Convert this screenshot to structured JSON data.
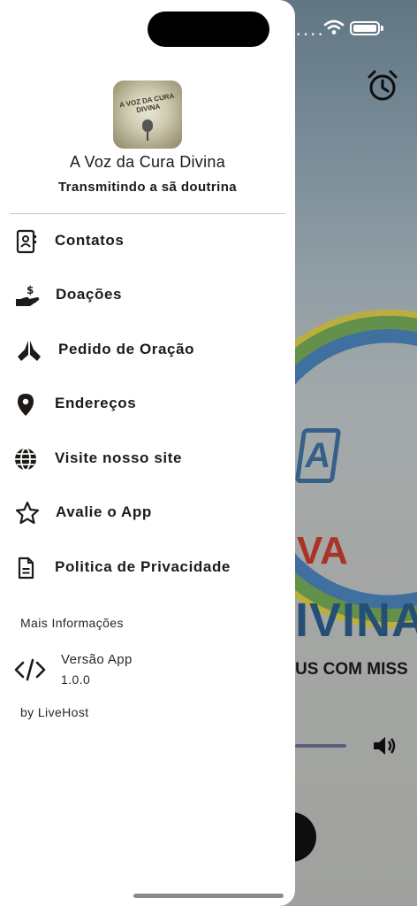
{
  "status_bar": {
    "wifi_icon": "wifi-icon",
    "battery_icon": "battery-icon"
  },
  "background": {
    "alarm_icon": "alarm-clock-icon",
    "logo_letter": "A",
    "partial_title_1": "VA",
    "partial_title_2": "IVINA",
    "partial_slogan": "US COM MISS",
    "volume_icon": "speaker-icon"
  },
  "drawer": {
    "app_name": "A Voz da Cura Divina",
    "tagline": "Transmitindo a sã doutrina",
    "logo_text": "A VOZ DA CURA DIVINA",
    "menu": [
      {
        "label": "Contatos",
        "icon": "contacts-book-icon"
      },
      {
        "label": "Doações",
        "icon": "donation-hand-icon"
      },
      {
        "label": "Pedido de Oração",
        "icon": "praying-hands-icon"
      },
      {
        "label": "Endereços",
        "icon": "location-pin-icon"
      },
      {
        "label": "Visite nosso site",
        "icon": "globe-icon"
      },
      {
        "label": "Avalie o App",
        "icon": "star-icon"
      },
      {
        "label": "Politica de Privacidade",
        "icon": "document-icon"
      }
    ],
    "more_info_title": "Mais Informações",
    "version_label": "Versão App",
    "version_value": "1.0.0",
    "version_icon": "code-icon",
    "byline": "by LiveHost"
  },
  "colors": {
    "text": "#1d1a17",
    "drawer_bg": "#ffffff",
    "divider": "#c9c6c2"
  }
}
